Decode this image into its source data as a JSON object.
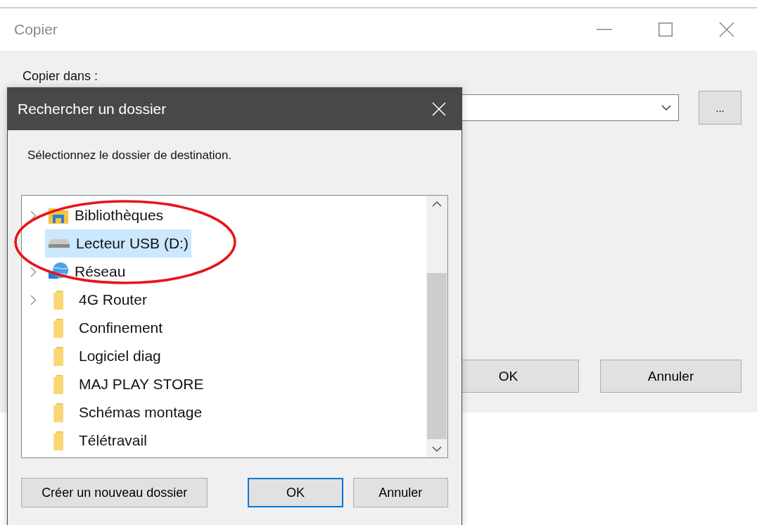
{
  "copy_window": {
    "title": "Copier",
    "label": "Copier dans :",
    "browse_button": "...",
    "buttons": [
      {
        "label": "OK"
      },
      {
        "label": "Annuler"
      }
    ]
  },
  "browse_dialog": {
    "title": "Rechercher un dossier",
    "instruction": "Sélectionnez le dossier de destination.",
    "tree": [
      {
        "label": "Bibliothèques",
        "kind": "library",
        "expandable": true,
        "selected": false
      },
      {
        "label": "Lecteur USB (D:)",
        "kind": "drive",
        "expandable": false,
        "selected": true
      },
      {
        "label": "Réseau",
        "kind": "network",
        "expandable": true,
        "selected": false
      },
      {
        "label": "4G Router",
        "kind": "folder",
        "expandable": true,
        "selected": false
      },
      {
        "label": "Confinement",
        "kind": "folder",
        "expandable": false,
        "selected": false
      },
      {
        "label": "Logiciel diag",
        "kind": "folder",
        "expandable": false,
        "selected": false
      },
      {
        "label": "MAJ PLAY STORE",
        "kind": "folder",
        "expandable": false,
        "selected": false
      },
      {
        "label": "Schémas montage",
        "kind": "folder",
        "expandable": false,
        "selected": false
      },
      {
        "label": "Télétravail",
        "kind": "folder",
        "expandable": false,
        "selected": false
      }
    ],
    "buttons": [
      {
        "label": "Créer un nouveau dossier",
        "default": false
      },
      {
        "label": "OK",
        "default": true
      },
      {
        "label": "Annuler",
        "default": false
      }
    ]
  }
}
